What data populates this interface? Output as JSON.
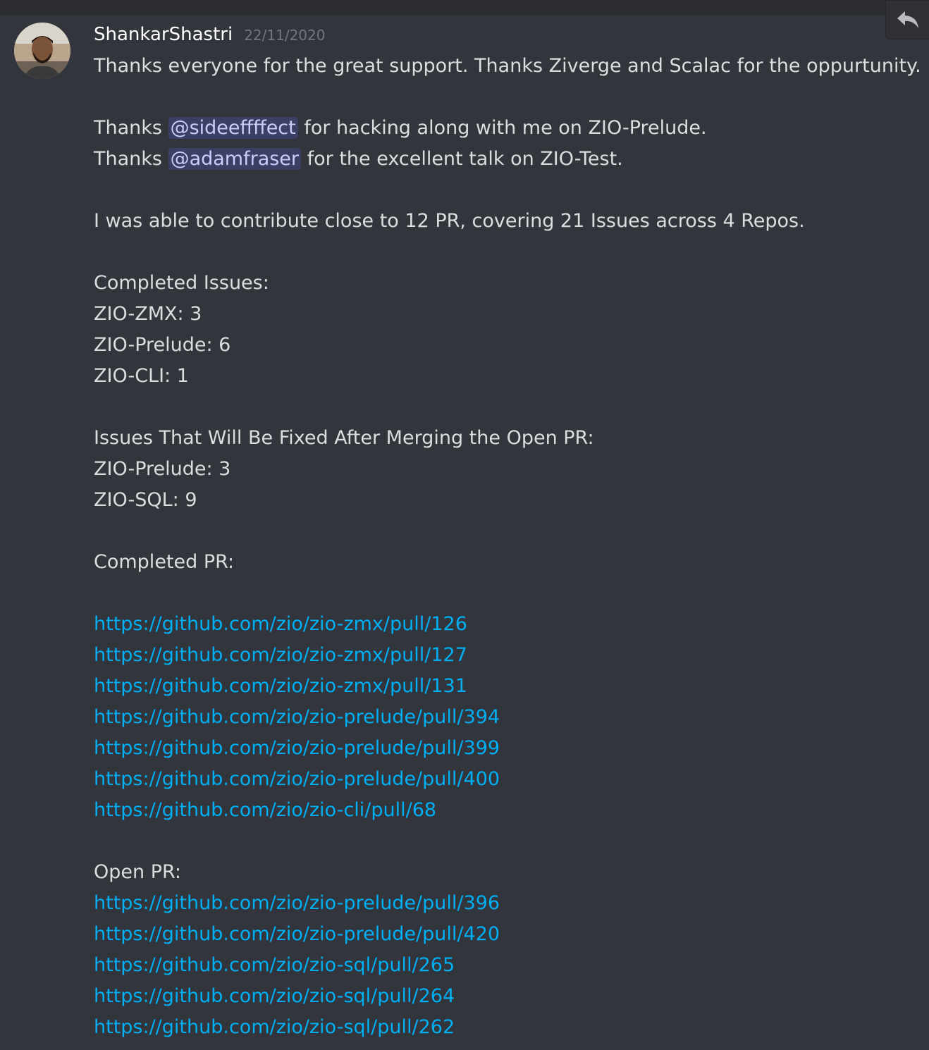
{
  "message": {
    "author": "ShankarShastri",
    "timestamp": "22/11/2020",
    "intro": "Thanks everyone for the great support. Thanks Ziverge and Scalac for the oppurtunity.",
    "thanks": [
      {
        "prefix": "Thanks",
        "mention": "@sideeffffect",
        "suffix": "for hacking along with me on ZIO-Prelude."
      },
      {
        "prefix": "Thanks",
        "mention": "@adamfraser",
        "suffix": "for the excellent talk on ZIO-Test."
      }
    ],
    "summary": "I was able to contribute close to 12 PR, covering 21 Issues across 4 Repos.",
    "completed_issues": {
      "heading": "Completed Issues:",
      "items": [
        "ZIO-ZMX: 3",
        "ZIO-Prelude: 6",
        "ZIO-CLI: 1"
      ]
    },
    "open_issues": {
      "heading": "Issues That Will Be Fixed After Merging the Open PR:",
      "items": [
        "ZIO-Prelude: 3",
        "ZIO-SQL: 9"
      ]
    },
    "completed_pr": {
      "heading": "Completed PR:",
      "links": [
        "https://github.com/zio/zio-zmx/pull/126",
        "https://github.com/zio/zio-zmx/pull/127",
        "https://github.com/zio/zio-zmx/pull/131",
        "https://github.com/zio/zio-prelude/pull/394",
        "https://github.com/zio/zio-prelude/pull/399",
        "https://github.com/zio/zio-prelude/pull/400",
        "https://github.com/zio/zio-cli/pull/68"
      ]
    },
    "open_pr": {
      "heading": "Open PR:",
      "links": [
        "https://github.com/zio/zio-prelude/pull/396",
        "https://github.com/zio/zio-prelude/pull/420",
        "https://github.com/zio/zio-sql/pull/265",
        "https://github.com/zio/zio-sql/pull/264",
        "https://github.com/zio/zio-sql/pull/262"
      ]
    }
  },
  "toolbar": {
    "reply_icon": "reply-icon"
  },
  "colors": {
    "background": "#32353b",
    "username": "#ffffff",
    "timestamp": "#72767d",
    "text": "#dcddde",
    "link": "#00aff4",
    "mention_bg": "rgba(88,101,242,0.22)",
    "mention_text": "#c9cdfb"
  }
}
